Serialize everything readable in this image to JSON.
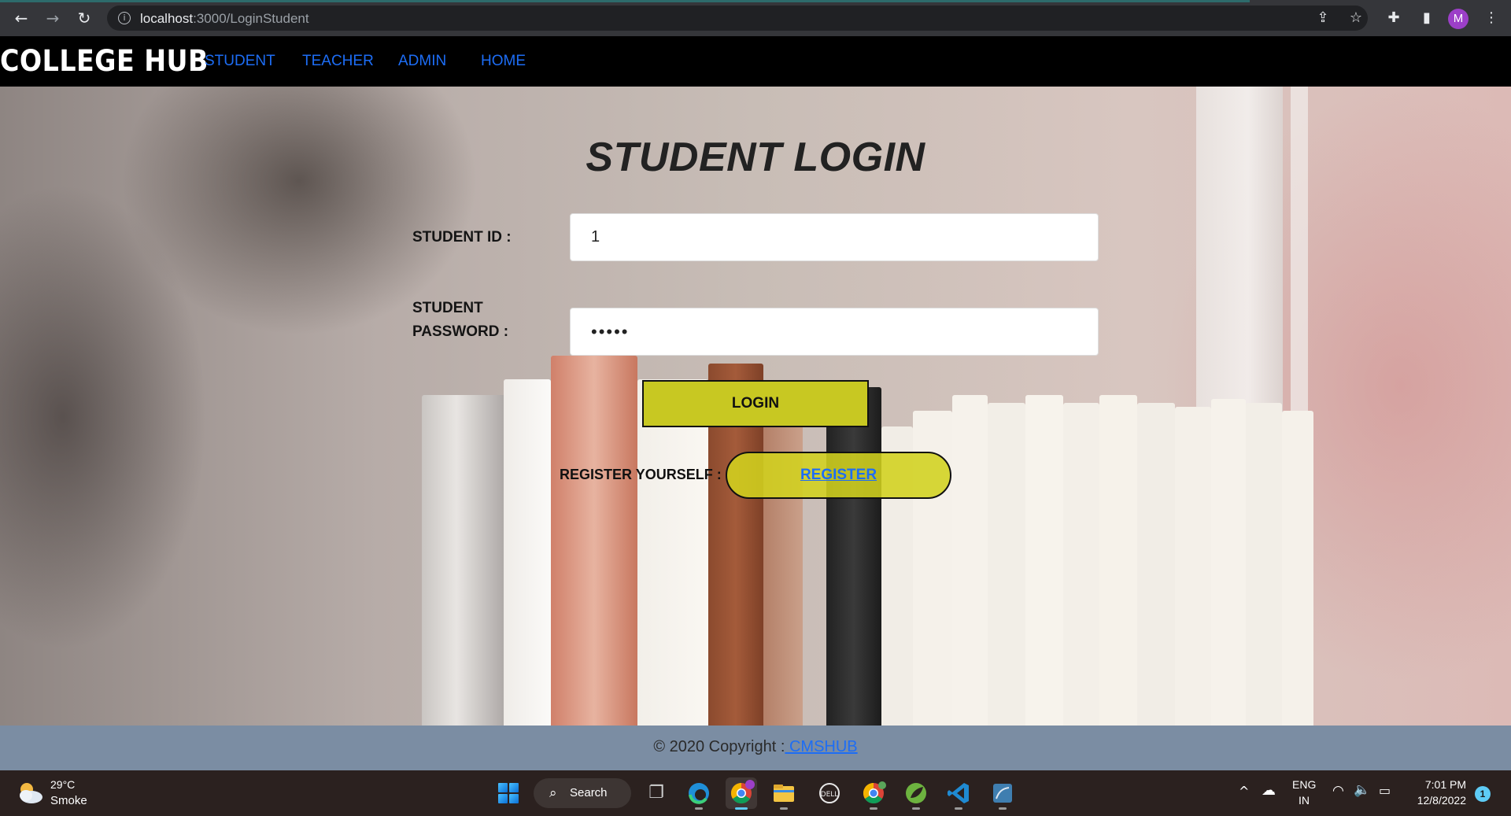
{
  "browser": {
    "url_host": "localhost",
    "url_path": ":3000/LoginStudent",
    "profile_initial": "M",
    "icons": [
      "back-arrow-icon",
      "forward-arrow-icon",
      "reload-icon",
      "info-icon",
      "share-icon",
      "star-icon",
      "puzzle-extension-icon",
      "side-panel-icon",
      "kebab-menu-icon"
    ]
  },
  "site": {
    "logo": "COLLEGE HUB",
    "nav": {
      "student": "STUDENT",
      "teacher": "TEACHER",
      "admin": "ADMIN",
      "home": "HOME"
    },
    "link_color": "#1d6df5"
  },
  "login": {
    "title": "STUDENT LOGIN",
    "id_label": "STUDENT ID :",
    "id_value": "1",
    "password_label_line1": "STUDENT",
    "password_label_line2": "PASSWORD :",
    "password_value": "•••••",
    "login_button": "LOGIN",
    "register_prompt": "REGISTER YOURSELF :",
    "register_button": "REGISTER",
    "button_color": "#c8c822"
  },
  "footer": {
    "copyright": "© 2020 Copyright :",
    "link": " CMSHUB"
  },
  "taskbar": {
    "weather_temp": "29°C",
    "weather_condition": "Smoke",
    "search_label": "Search",
    "lang_line1": "ENG",
    "lang_line2": "IN",
    "time": "7:01 PM",
    "date": "12/8/2022",
    "notifications": "1",
    "apps": [
      "windows-start",
      "search",
      "task-view",
      "edge",
      "chrome",
      "file-explorer",
      "dell",
      "chrome-canary",
      "spring-tool-suite",
      "vs-code",
      "mysql-workbench"
    ]
  }
}
